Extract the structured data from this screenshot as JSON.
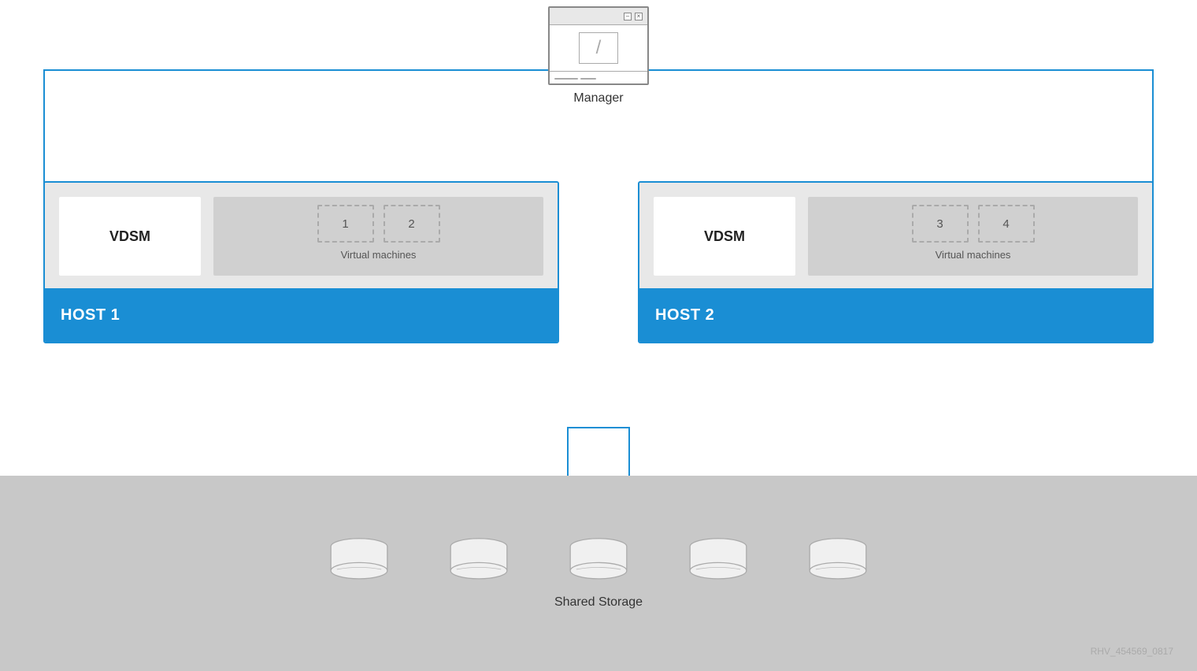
{
  "manager": {
    "label": "Manager",
    "titlebar": {
      "minimize": "–",
      "close": "×"
    }
  },
  "host1": {
    "label": "HOST 1",
    "vdsm_label": "VDSM",
    "vm_label": "Virtual machines",
    "vm1": "1",
    "vm2": "2"
  },
  "host2": {
    "label": "HOST 2",
    "vdsm_label": "VDSM",
    "vm_label": "Virtual machines",
    "vm3": "3",
    "vm4": "4"
  },
  "storage": {
    "label": "Shared Storage",
    "disk_count": 5
  },
  "watermark": {
    "text": "RHV_454569_0817"
  }
}
